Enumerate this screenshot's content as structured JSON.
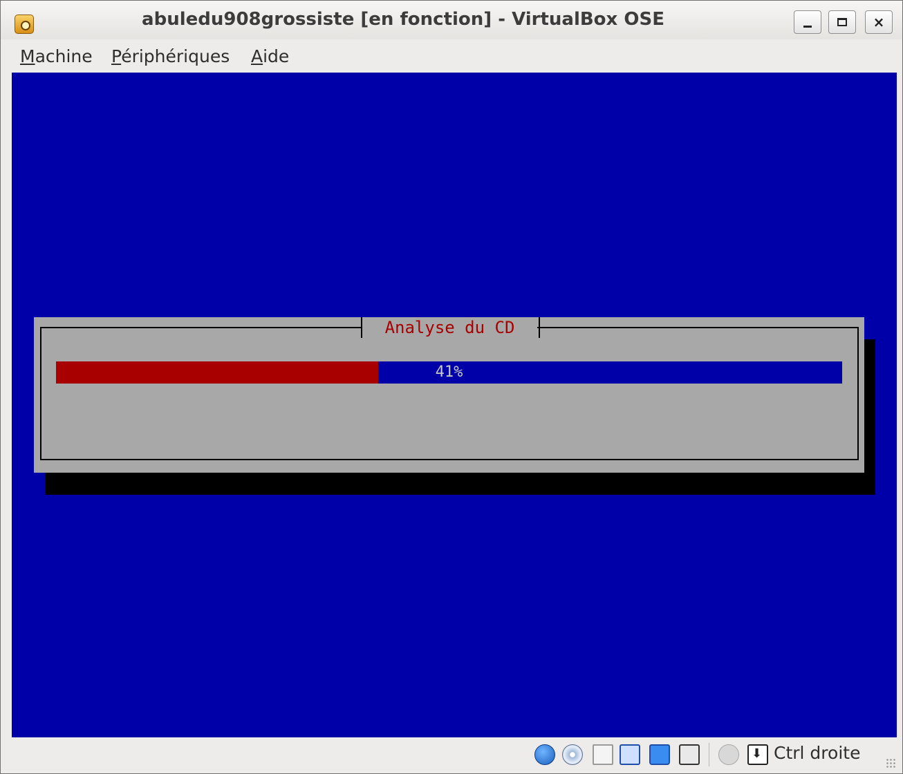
{
  "window": {
    "title": "abuledu908grossiste [en fonction] - VirtualBox OSE",
    "controls": {
      "minimize": "minimize",
      "maximize": "maximize",
      "close": "×"
    }
  },
  "menubar": {
    "items": [
      {
        "label": "Machine",
        "mnemonic": "M",
        "rest": "achine"
      },
      {
        "label": "Périphériques",
        "mnemonic": "P",
        "rest": "ériphériques"
      },
      {
        "label": "Aide",
        "mnemonic": "A",
        "rest": "ide"
      }
    ]
  },
  "installer": {
    "dialog_title": "Analyse du CD",
    "progress_percent": 41,
    "progress_text": "41%",
    "colors": {
      "screen": "#0000a8",
      "dialog": "#a8a8a8",
      "progress_fill": "#a80000",
      "title_text": "#a80000"
    }
  },
  "statusbar": {
    "icons": [
      "hard-disk-icon",
      "cd-dvd-icon",
      "floppy-icon",
      "network-icon",
      "shared-folder-icon",
      "vt-x-icon",
      "mouse-integration-icon",
      "host-key-icon"
    ],
    "host_key_label": "Ctrl droite"
  }
}
